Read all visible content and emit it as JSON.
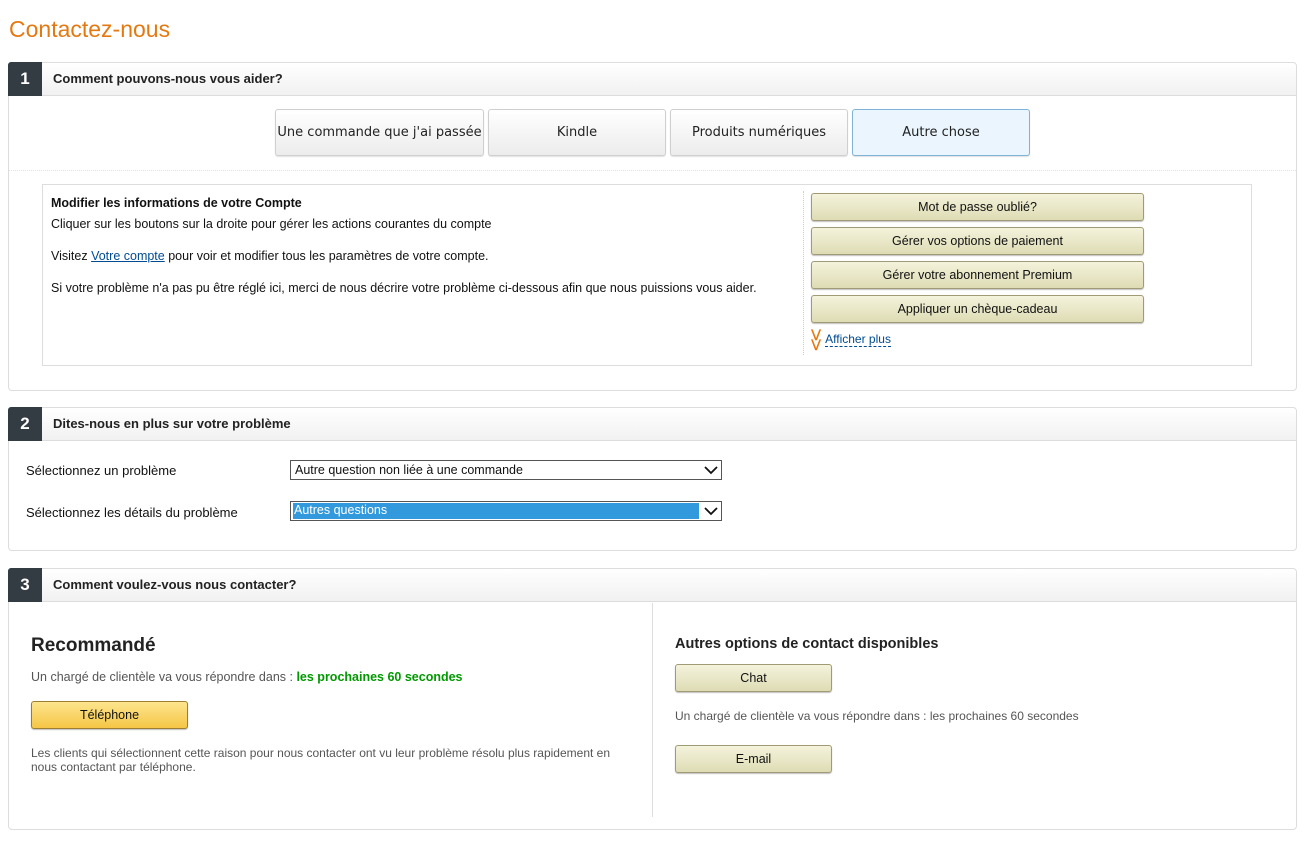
{
  "page": {
    "title": "Contactez-nous"
  },
  "step1": {
    "number": "1",
    "title": "Comment pouvons-nous vous aider?",
    "categories": [
      {
        "label": "Une commande que j'ai passée",
        "selected": false
      },
      {
        "label": "Kindle",
        "selected": false
      },
      {
        "label": "Produits numériques",
        "selected": false
      },
      {
        "label": "Autre chose",
        "selected": true
      }
    ],
    "info": {
      "heading": "Modifier les informations de votre Compte",
      "line1": "Cliquer sur les boutons sur la droite pour gérer les actions courantes du compte",
      "visit_prefix": "Visitez ",
      "visit_link": "Votre compte",
      "visit_suffix": " pour voir et modifier tous les paramètres de votre compte.",
      "line3": "Si votre problème n'a pas pu être réglé ici, merci de nous décrire votre problème ci-dessous afin que nous puissions vous aider."
    },
    "actions": [
      "Mot de passe oublié?",
      "Gérer vos options de paiement",
      "Gérer votre abonnement Premium",
      "Appliquer un chèque-cadeau"
    ],
    "show_more": "Afficher plus"
  },
  "step2": {
    "number": "2",
    "title": "Dites-nous en plus sur votre problème",
    "problem_label": "Sélectionnez un problème",
    "problem_value": "Autre question non liée à une commande",
    "details_label": "Sélectionnez les détails du problème",
    "details_value": "Autres questions"
  },
  "step3": {
    "number": "3",
    "title": "Comment voulez-vous nous contacter?",
    "recommended": {
      "title": "Recommandé",
      "wait_prefix": "Un chargé de clientèle va vous répondre dans : ",
      "wait_time": "les prochaines 60 secondes",
      "button": "Téléphone",
      "note": "Les clients qui sélectionnent cette raison pour nous contacter ont vu leur problème résolu plus rapidement en nous contactant par téléphone."
    },
    "other": {
      "title": "Autres options de contact disponibles",
      "chat_button": "Chat",
      "chat_wait": "Un chargé de clientèle va vous répondre dans : les prochaines 60 secondes",
      "email_button": "E-mail"
    }
  },
  "colors": {
    "accent_orange": "#e47911",
    "link_blue": "#004b91",
    "wait_green": "#009900",
    "step_badge": "#333b43"
  }
}
